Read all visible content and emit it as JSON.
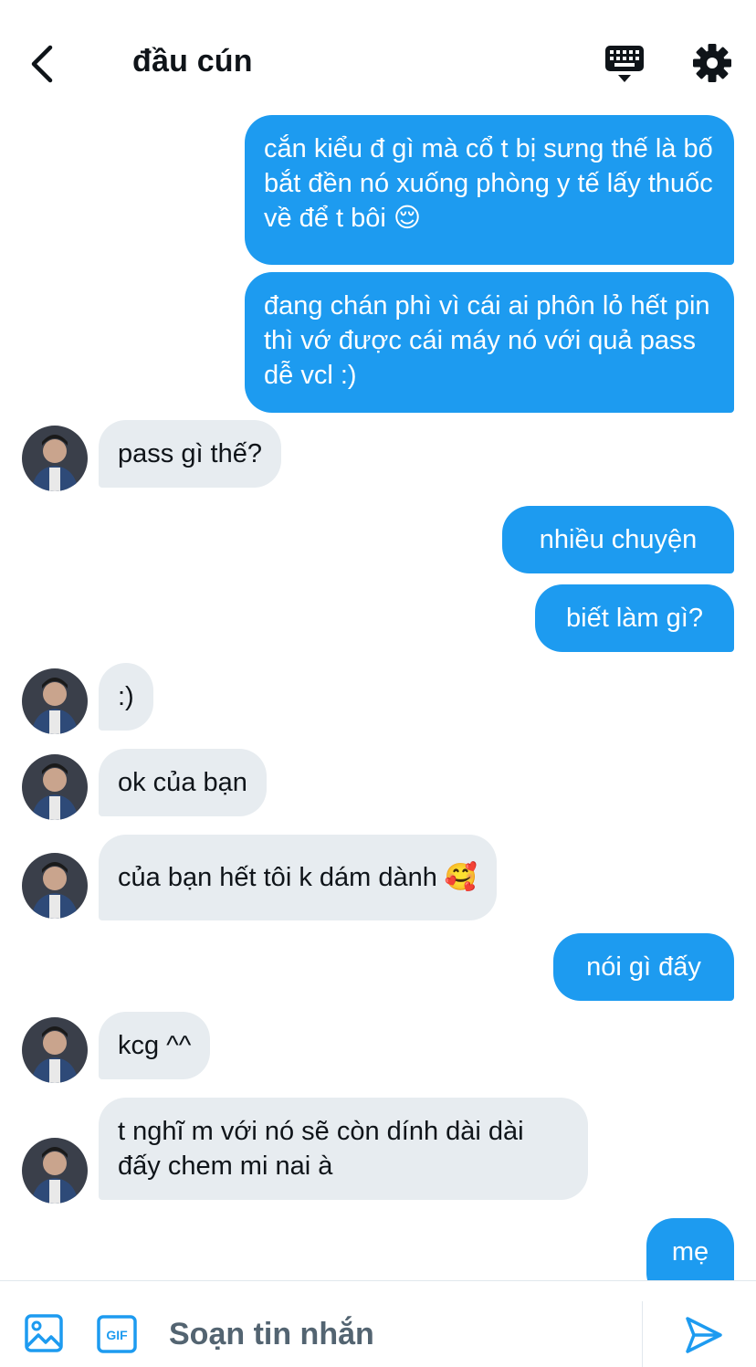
{
  "header": {
    "title": "đầu cún",
    "icons": {
      "back": "chevron-left-icon",
      "keyboard": "keyboard-icon",
      "settings": "gear-icon"
    }
  },
  "messages": [
    {
      "from": "me",
      "text": "cắn kiểu đ gì mà cổ t bị sưng thế là bố bắt đền nó xuống phòng y tế lấy thuốc về để t bôi 😌"
    },
    {
      "from": "me",
      "text": "đang chán phì vì cái ai phôn lỏ hết pin thì vớ được cái máy nó với quả pass dễ vcl :)"
    },
    {
      "from": "them",
      "text": "pass gì thế?"
    },
    {
      "from": "me",
      "text": "nhiều chuyện"
    },
    {
      "from": "me",
      "text": "biết làm gì?"
    },
    {
      "from": "them",
      "text": ":)"
    },
    {
      "from": "them",
      "text": "ok của bạn"
    },
    {
      "from": "them",
      "text": "của bạn hết tôi k dám dành 🥰"
    },
    {
      "from": "me",
      "text": "nói gì đấy"
    },
    {
      "from": "them",
      "text": "kcg ^^"
    },
    {
      "from": "them",
      "text": "t nghĩ m với nó sẽ còn dính dài dài đấy chem mi nai à"
    },
    {
      "from": "me",
      "text": "mẹ"
    }
  ],
  "composer": {
    "placeholder": "Soạn tin nhắn",
    "gif_label": "GIF",
    "icons": {
      "media": "image-icon",
      "gif": "gif-icon",
      "send": "send-icon"
    }
  },
  "colors": {
    "accent": "#1d9bf0",
    "incoming_bubble": "#e7ecf0",
    "text": "#0f1419",
    "muted": "#536471"
  }
}
